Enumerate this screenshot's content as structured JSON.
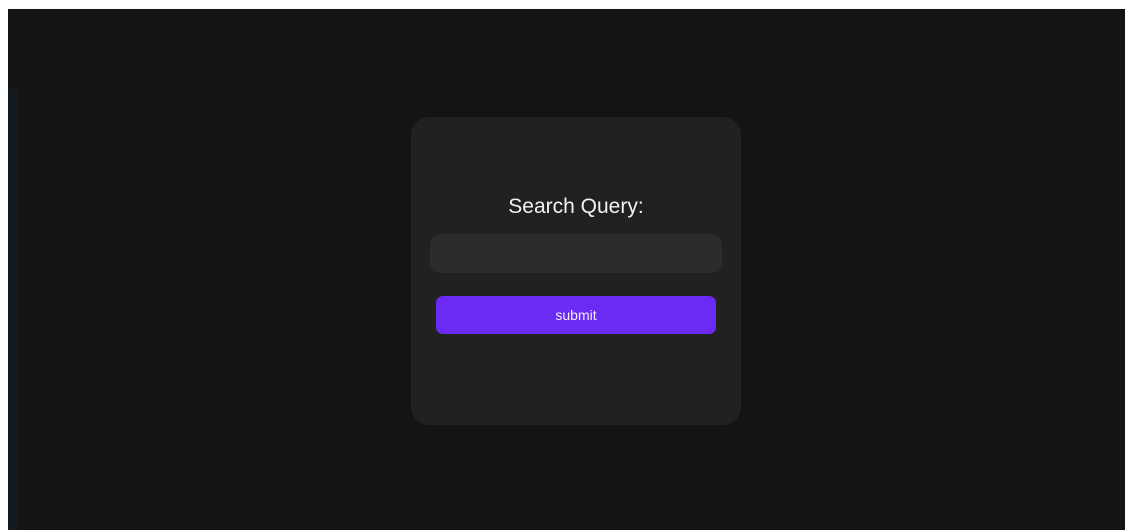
{
  "search_form": {
    "label": "Search Query:",
    "input_value": "",
    "input_placeholder": "",
    "submit_label": "submit"
  },
  "colors": {
    "page_background": "#141414",
    "card_background": "#212121",
    "input_background": "#2c2c2c",
    "accent": "#6c2bf5",
    "text": "#f2f2f2"
  }
}
